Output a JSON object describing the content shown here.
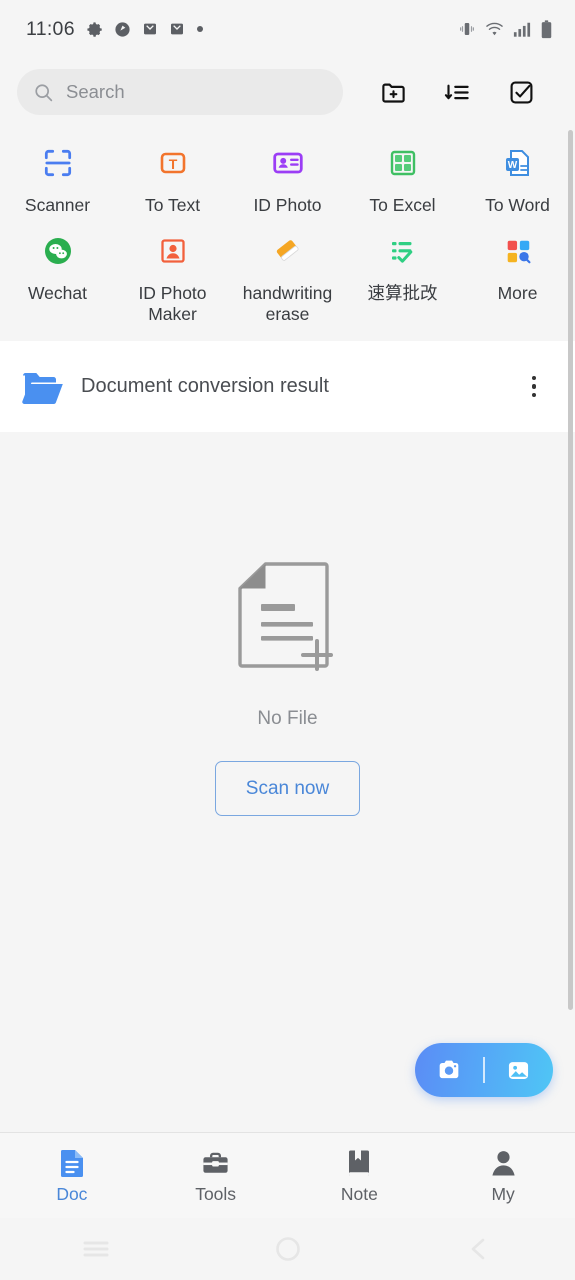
{
  "status_bar": {
    "time": "11:06",
    "left_icons": [
      "gear-icon",
      "clock-icon",
      "mail-icon",
      "mail-icon",
      "dot-icon"
    ],
    "right_icons": [
      "vibrate-icon",
      "wifi-icon",
      "signal-icon",
      "battery-icon"
    ]
  },
  "search": {
    "placeholder": "Search",
    "icon": "search-icon"
  },
  "top_actions": [
    {
      "name": "new-folder",
      "icon": "folder-plus-icon"
    },
    {
      "name": "sort",
      "icon": "sort-list-icon"
    },
    {
      "name": "select",
      "icon": "checkbox-check-icon"
    }
  ],
  "tools": {
    "row1": [
      {
        "label": "Scanner",
        "icon": "scan-frame-icon",
        "color": "#4a7df0"
      },
      {
        "label": "To Text",
        "icon": "text-t-icon",
        "color": "#f2742c"
      },
      {
        "label": "ID Photo",
        "icon": "id-card-icon",
        "color": "#9b3df5"
      },
      {
        "label": "To Excel",
        "icon": "excel-grid-icon",
        "color": "#3fbf63"
      },
      {
        "label": "To Word",
        "icon": "word-doc-icon",
        "color": "#3f8ee0"
      }
    ],
    "row2": [
      {
        "label": "Wechat",
        "icon": "wechat-icon",
        "color": "#2aae4f"
      },
      {
        "label": "ID Photo Maker",
        "icon": "person-frame-icon",
        "color": "#f2603c"
      },
      {
        "label": "handwriting erase",
        "icon": "eraser-icon",
        "color": "#f5a623"
      },
      {
        "label": "速算批改",
        "icon": "list-check-icon",
        "color": "#2fcf83"
      },
      {
        "label": "More",
        "icon": "grid-more-icon",
        "color": "#4a90e2"
      }
    ]
  },
  "folder": {
    "name": "Document conversion result",
    "icon": "open-folder-icon",
    "menu_icon": "more-vertical-icon"
  },
  "empty_state": {
    "icon": "document-add-icon",
    "text": "No File",
    "button_label": "Scan now"
  },
  "fab": {
    "camera_icon": "camera-icon",
    "gallery_icon": "image-icon"
  },
  "bottom_nav": [
    {
      "label": "Doc",
      "icon": "document-icon",
      "active": true
    },
    {
      "label": "Tools",
      "icon": "toolbox-icon",
      "active": false
    },
    {
      "label": "Note",
      "icon": "bookmark-icon",
      "active": false
    },
    {
      "label": "My",
      "icon": "person-icon",
      "active": false
    }
  ],
  "android_nav": [
    {
      "name": "recents",
      "icon": "menu-lines-icon"
    },
    {
      "name": "home",
      "icon": "circle-icon"
    },
    {
      "name": "back",
      "icon": "chevron-left-icon"
    }
  ],
  "colors": {
    "accent": "#4a87d8",
    "page_bg": "#f5f5f5",
    "card_bg": "#ffffff"
  }
}
